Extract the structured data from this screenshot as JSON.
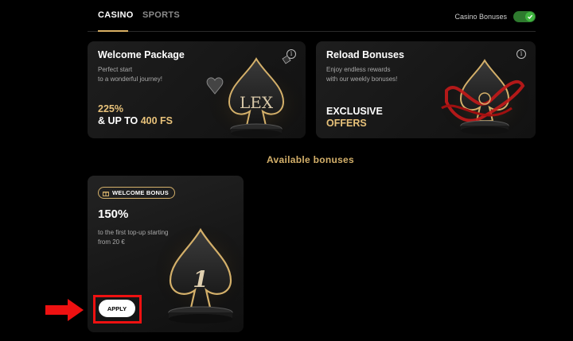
{
  "tabs": [
    {
      "label": "CASINO",
      "active": true
    },
    {
      "label": "SPORTS",
      "active": false
    }
  ],
  "toggle": {
    "label": "Casino Bonuses",
    "on": true
  },
  "cards": {
    "welcome": {
      "title": "Welcome Package",
      "subtitle_1": "Perfect start",
      "subtitle_2": "to a wonderful journey!",
      "offer_line_1": "225%",
      "offer_line_2_prefix": "& UP TO ",
      "offer_line_2_highlight": "400 FS",
      "art_text": "LEX"
    },
    "reload": {
      "title": "Reload Bonuses",
      "subtitle_1": "Enjoy endless rewards",
      "subtitle_2": "with our weekly bonuses!",
      "offer_line_1": "EXCLUSIVE",
      "offer_line_2": "OFFERS"
    }
  },
  "section_title": "Available bonuses",
  "bonus": {
    "badge": "WELCOME BONUS",
    "percent": "150%",
    "desc_1": "to the first top-up starting",
    "desc_2": "from 20 €",
    "apply_label": "APPLY",
    "art_number": "1"
  },
  "colors": {
    "gold": "#d4b06a",
    "toggle_green": "#3fb53f",
    "highlight_red": "#e11111"
  }
}
